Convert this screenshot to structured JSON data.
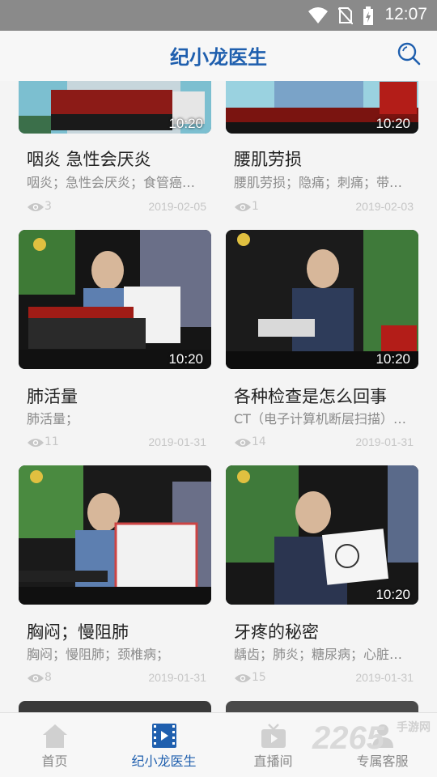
{
  "status_bar": {
    "time": "12:07"
  },
  "app_bar": {
    "title": "纪小龙医生",
    "search_icon": "search-icon"
  },
  "videos": [
    {
      "title": "咽炎 急性会厌炎",
      "tags": "咽炎；急性会厌炎；食管癌…",
      "views": "3",
      "date": "2019-02-05",
      "duration": "10:20"
    },
    {
      "title": "腰肌劳损",
      "tags": "腰肌劳损；隐痛；刺痛；带…",
      "views": "1",
      "date": "2019-02-03",
      "duration": "10:20"
    },
    {
      "title": "肺活量",
      "tags": "肺活量；",
      "views": "11",
      "date": "2019-01-31",
      "duration": "10:20"
    },
    {
      "title": "各种检查是怎么回事",
      "tags": "CT（电子计算机断层扫描）…",
      "views": "14",
      "date": "2019-01-31",
      "duration": "10:20"
    },
    {
      "title": "胸闷；慢阻肺",
      "tags": "胸闷；慢阻肺；颈椎病；",
      "views": "8",
      "date": "2019-01-31",
      "duration": ""
    },
    {
      "title": "牙疼的秘密",
      "tags": "龋齿；肺炎；糖尿病；心脏…",
      "views": "15",
      "date": "2019-01-31",
      "duration": "10:20"
    }
  ],
  "tabs": [
    {
      "label": "首页",
      "icon": "home-icon"
    },
    {
      "label": "纪小龙医生",
      "icon": "video-film-icon"
    },
    {
      "label": "直播间",
      "icon": "tv-icon"
    },
    {
      "label": "专属客服",
      "icon": "person-icon"
    }
  ],
  "watermark": {
    "number": "2265",
    "site": "手游网"
  },
  "colors": {
    "brand": "#1f5fae",
    "status_bar": "#8a8a8a",
    "meta_text": "#c6c6c6"
  }
}
